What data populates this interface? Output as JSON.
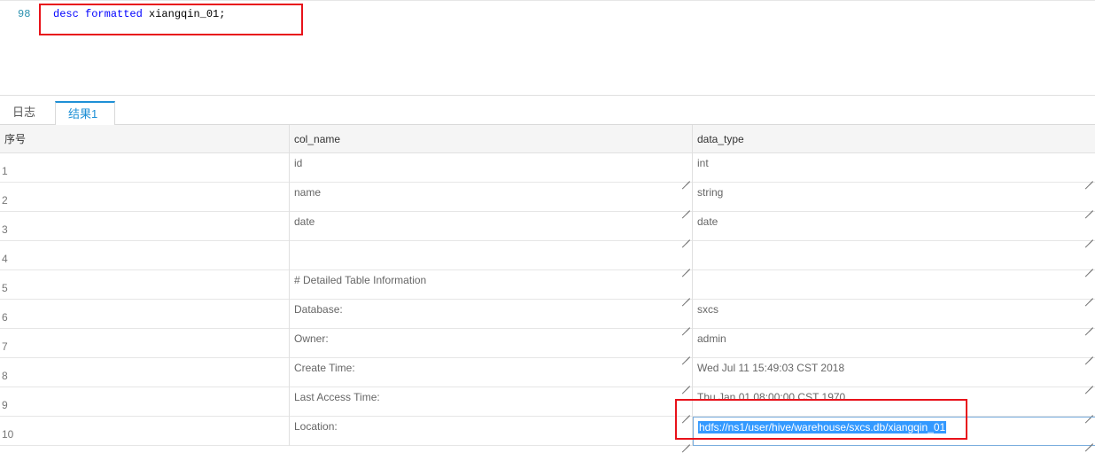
{
  "editor": {
    "line_number": "98",
    "code_keyword1": "desc",
    "code_keyword2": "formatted",
    "code_rest": "xiangqin_01;"
  },
  "tabs": [
    {
      "label": "日志",
      "active": false
    },
    {
      "label": "结果1",
      "active": true
    }
  ],
  "grid": {
    "headers": [
      "序号",
      "col_name",
      "data_type"
    ],
    "rows": [
      {
        "idx": "1",
        "col_name": "id",
        "data_type": "int"
      },
      {
        "idx": "2",
        "col_name": "name",
        "data_type": "string"
      },
      {
        "idx": "3",
        "col_name": "date",
        "data_type": "date"
      },
      {
        "idx": "4",
        "col_name": "",
        "data_type": ""
      },
      {
        "idx": "5",
        "col_name": "# Detailed Table Information",
        "data_type": ""
      },
      {
        "idx": "6",
        "col_name": "Database:",
        "data_type": "sxcs"
      },
      {
        "idx": "7",
        "col_name": "Owner:",
        "data_type": "admin"
      },
      {
        "idx": "8",
        "col_name": "Create Time:",
        "data_type": "Wed Jul 11 15:49:03 CST 2018"
      },
      {
        "idx": "9",
        "col_name": "Last Access Time:",
        "data_type": "Thu Jan 01 08:00:00 CST 1970"
      },
      {
        "idx": "10",
        "col_name": "Location:",
        "data_type": "hdfs://ns1/user/hive/warehouse/sxcs.db/xiangqin_01"
      }
    ]
  },
  "colors": {
    "annotation_red": "#e8121a",
    "accent_blue": "#1e90d6",
    "selection_blue": "#3399ff"
  }
}
